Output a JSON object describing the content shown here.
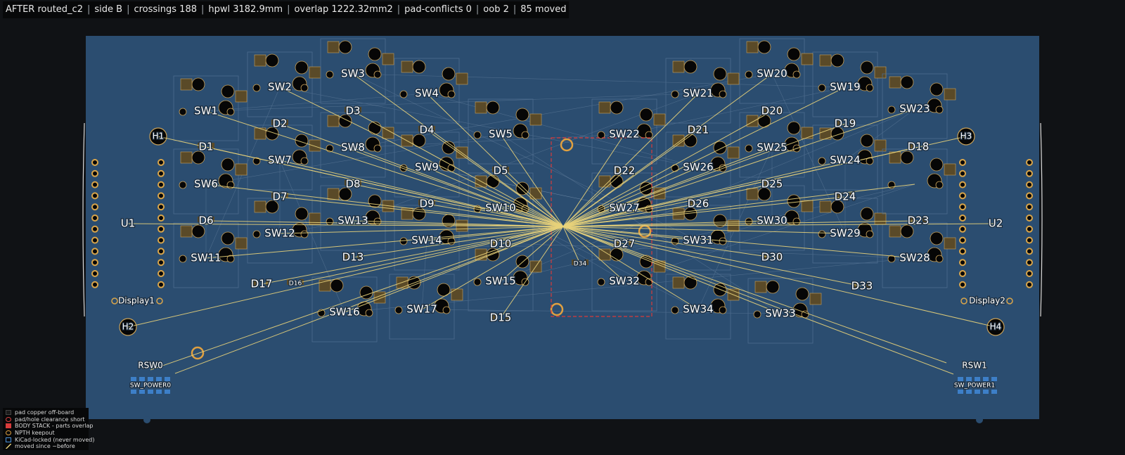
{
  "status": {
    "title": "AFTER routed_c2",
    "side": "side B",
    "crossings": "crossings 188",
    "hpwl": "hpwl 3182.9mm",
    "overlap": "overlap 1222.32mm2",
    "pad_conflicts": "pad-conflicts 0",
    "oob": "oob 2",
    "moved": "85 moved"
  },
  "colors": {
    "background": "#101215",
    "board": "#2b4d70",
    "ratsnest": "#e8d27a",
    "keepout": "#e0a040",
    "body_stack": "#d83b3b",
    "copper_offboard": "#1a1a1a",
    "locked": "#4a90d9"
  },
  "footprints": {
    "switches": [
      {
        "ref": "SW1"
      },
      {
        "ref": "SW2"
      },
      {
        "ref": "SW3"
      },
      {
        "ref": "SW4"
      },
      {
        "ref": "SW5"
      },
      {
        "ref": "SW6"
      },
      {
        "ref": "SW7"
      },
      {
        "ref": "SW8"
      },
      {
        "ref": "SW9"
      },
      {
        "ref": "SW10"
      },
      {
        "ref": "SW11"
      },
      {
        "ref": "SW12"
      },
      {
        "ref": "SW13"
      },
      {
        "ref": "SW14"
      },
      {
        "ref": "SW15"
      },
      {
        "ref": "SW16"
      },
      {
        "ref": "SW17"
      },
      {
        "ref": "SW19"
      },
      {
        "ref": "SW20"
      },
      {
        "ref": "SW21"
      },
      {
        "ref": "SW22"
      },
      {
        "ref": "SW23"
      },
      {
        "ref": "SW24"
      },
      {
        "ref": "SW25"
      },
      {
        "ref": "SW26"
      },
      {
        "ref": "SW27"
      },
      {
        "ref": "SW28"
      },
      {
        "ref": "SW29"
      },
      {
        "ref": "SW30"
      },
      {
        "ref": "SW31"
      },
      {
        "ref": "SW32"
      },
      {
        "ref": "SW33"
      },
      {
        "ref": "SW34"
      }
    ],
    "diodes": [
      {
        "ref": "D1"
      },
      {
        "ref": "D2"
      },
      {
        "ref": "D3"
      },
      {
        "ref": "D4"
      },
      {
        "ref": "D5"
      },
      {
        "ref": "D6"
      },
      {
        "ref": "D7"
      },
      {
        "ref": "D8"
      },
      {
        "ref": "D9"
      },
      {
        "ref": "D10"
      },
      {
        "ref": "D13"
      },
      {
        "ref": "D15"
      },
      {
        "ref": "D16"
      },
      {
        "ref": "D17"
      },
      {
        "ref": "D18"
      },
      {
        "ref": "D19"
      },
      {
        "ref": "D20"
      },
      {
        "ref": "D21"
      },
      {
        "ref": "D22"
      },
      {
        "ref": "D23"
      },
      {
        "ref": "D24"
      },
      {
        "ref": "D25"
      },
      {
        "ref": "D26"
      },
      {
        "ref": "D27"
      },
      {
        "ref": "D30"
      },
      {
        "ref": "D33"
      },
      {
        "ref": "D34"
      }
    ],
    "holes": [
      {
        "ref": "H1"
      },
      {
        "ref": "H2"
      },
      {
        "ref": "H3"
      },
      {
        "ref": "H4"
      }
    ],
    "mcus": [
      {
        "ref": "U1"
      },
      {
        "ref": "U2"
      }
    ],
    "displays": [
      {
        "ref": "Display1"
      },
      {
        "ref": "Display2"
      }
    ],
    "misc": [
      {
        "ref": "RSW0"
      },
      {
        "ref": "RSW1"
      },
      {
        "ref": "SW_POWER0"
      },
      {
        "ref": "SW_POWER1"
      }
    ]
  },
  "legend": [
    {
      "label": "pad copper off-board",
      "icon": "pad-offboard-icon"
    },
    {
      "label": "pad/hole clearance short",
      "icon": "clearance-short-icon"
    },
    {
      "label": "BODY STACK - parts overlap",
      "icon": "body-stack-icon"
    },
    {
      "label": "NPTH keepout",
      "icon": "npth-keepout-icon"
    },
    {
      "label": "KiCad-locked (never moved)",
      "icon": "locked-icon"
    },
    {
      "label": "moved since ~before",
      "icon": "moved-line-icon"
    }
  ]
}
